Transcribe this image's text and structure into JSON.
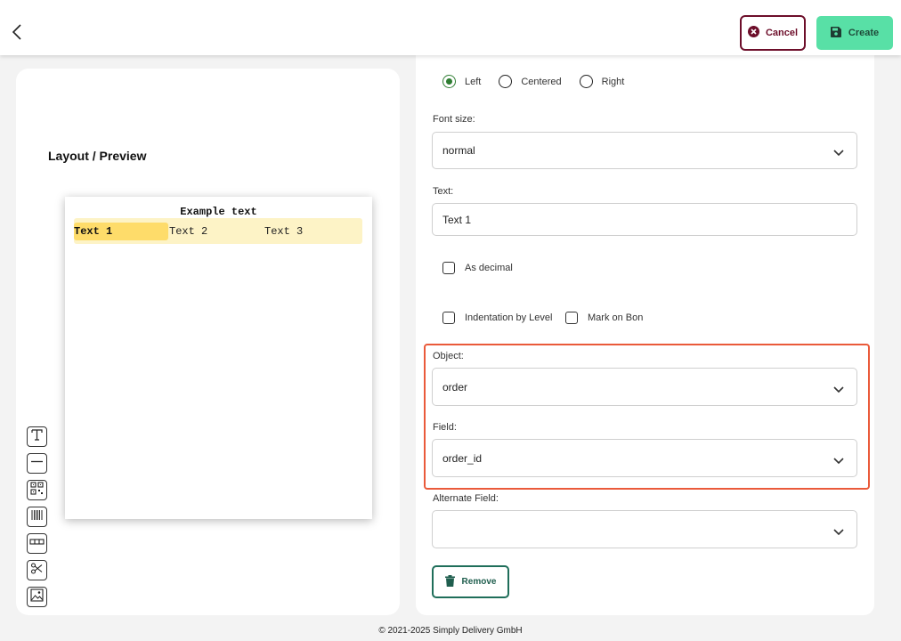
{
  "header": {
    "back_icon": "chevron-left-icon",
    "cancel_label": "Cancel",
    "cancel_icon": "x-circle-icon",
    "create_label": "Create",
    "create_icon": "save-icon"
  },
  "preview": {
    "title": "Layout / Preview",
    "paper_title": "Example text",
    "cells": [
      "Text 1",
      "Text 2",
      "Text 3"
    ],
    "selected_cell": 0
  },
  "tools": [
    {
      "name": "text-tool",
      "icon": "text-icon"
    },
    {
      "name": "line-tool",
      "icon": "line-icon"
    },
    {
      "name": "qr-tool",
      "icon": "qr-code-icon"
    },
    {
      "name": "barcode-tool",
      "icon": "barcode-icon"
    },
    {
      "name": "columns-tool",
      "icon": "columns-icon"
    },
    {
      "name": "cut-tool",
      "icon": "scissors-icon"
    },
    {
      "name": "image-tool",
      "icon": "image-icon"
    }
  ],
  "form": {
    "alignment": {
      "options": [
        "Left",
        "Centered",
        "Right"
      ],
      "selected": "Left"
    },
    "font_size": {
      "label": "Font size:",
      "value": "normal"
    },
    "text": {
      "label": "Text:",
      "value": "Text 1"
    },
    "as_decimal": {
      "label": "As decimal",
      "checked": false
    },
    "indentation": {
      "label": "Indentation by Level",
      "checked": false
    },
    "mark_on_bon": {
      "label": "Mark on Bon",
      "checked": false
    },
    "object": {
      "label": "Object:",
      "value": "order"
    },
    "field": {
      "label": "Field:",
      "value": "order_id"
    },
    "alternate_field": {
      "label": "Alternate Field:",
      "value": ""
    },
    "remove_label": "Remove"
  },
  "footer": {
    "copyright": "© 2021-2025 Simply Delivery GmbH"
  },
  "colors": {
    "create_bg": "#58e0a6",
    "cancel_border": "#6d0e2a",
    "highlight": "#ea5a3a",
    "radio_checked": "#2e7d32",
    "selected_cell": "#fedc6a",
    "row_bg": "#fdf3c6"
  }
}
